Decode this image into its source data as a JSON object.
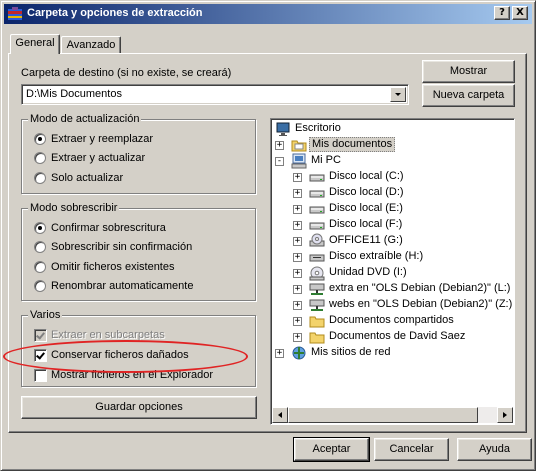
{
  "window": {
    "title": "Carpeta y opciones de extracción",
    "help_button": "?",
    "close_button": "X"
  },
  "tabs": [
    {
      "label": "General",
      "active": true
    },
    {
      "label": "Avanzado",
      "active": false
    }
  ],
  "destination": {
    "label": "Carpeta de destino (si no existe, se creará)",
    "value": "D:\\Mis Documentos",
    "show_button": "Mostrar",
    "new_folder_button": "Nueva carpeta"
  },
  "update_mode": {
    "legend": "Modo de actualización",
    "options": [
      {
        "label": "Extraer y reemplazar",
        "checked": true
      },
      {
        "label": "Extraer y actualizar",
        "checked": false
      },
      {
        "label": "Solo actualizar",
        "checked": false
      }
    ]
  },
  "overwrite_mode": {
    "legend": "Modo sobrescribir",
    "options": [
      {
        "label": "Confirmar sobrescritura",
        "checked": true
      },
      {
        "label": "Sobrescribir sin confirmación",
        "checked": false
      },
      {
        "label": "Omitir ficheros existentes",
        "checked": false
      },
      {
        "label": "Renombrar automaticamente",
        "checked": false
      }
    ]
  },
  "misc": {
    "legend": "Varios",
    "options": [
      {
        "label": "Extraer en subcarpetas",
        "checked": true,
        "disabled": true
      },
      {
        "label": "Conservar ficheros dañados",
        "checked": true,
        "disabled": false
      },
      {
        "label": "Mostrar ficheros en el Explorador",
        "checked": false,
        "disabled": false
      }
    ]
  },
  "save_options_button": "Guardar opciones",
  "tree": {
    "items": [
      {
        "label": "Escritorio",
        "icon": "desktop-icon",
        "level": 0,
        "expander": ""
      },
      {
        "label": "Mis documentos",
        "icon": "my-documents-folder-icon",
        "level": 1,
        "expander": "+",
        "selected": true
      },
      {
        "label": "Mi PC",
        "icon": "my-computer-icon",
        "level": 1,
        "expander": "-"
      },
      {
        "label": "Disco local (C:)",
        "icon": "hard-drive-icon",
        "level": 2,
        "expander": "+"
      },
      {
        "label": "Disco local (D:)",
        "icon": "hard-drive-icon",
        "level": 2,
        "expander": "+"
      },
      {
        "label": "Disco local (E:)",
        "icon": "hard-drive-icon",
        "level": 2,
        "expander": "+"
      },
      {
        "label": "Disco local (F:)",
        "icon": "hard-drive-icon",
        "level": 2,
        "expander": "+"
      },
      {
        "label": "OFFICE11 (G:)",
        "icon": "cd-drive-icon",
        "level": 2,
        "expander": "+"
      },
      {
        "label": "Disco extraíble (H:)",
        "icon": "removable-drive-icon",
        "level": 2,
        "expander": "+"
      },
      {
        "label": "Unidad DVD (I:)",
        "icon": "dvd-drive-icon",
        "level": 2,
        "expander": "+"
      },
      {
        "label": "extra en \"OLS Debian (Debian2)\" (L:)",
        "icon": "network-drive-icon",
        "level": 2,
        "expander": "+"
      },
      {
        "label": "webs en \"OLS Debian (Debian2)\" (Z:)",
        "icon": "network-drive-icon",
        "level": 2,
        "expander": "+"
      },
      {
        "label": "Documentos compartidos",
        "icon": "folder-icon",
        "level": 2,
        "expander": "+"
      },
      {
        "label": "Documentos de David Saez",
        "icon": "folder-icon",
        "level": 2,
        "expander": "+"
      },
      {
        "label": "Mis sitios de red",
        "icon": "network-places-icon",
        "level": 1,
        "expander": "+"
      }
    ]
  },
  "footer": {
    "accept": "Aceptar",
    "cancel": "Cancelar",
    "help": "Ayuda"
  },
  "colors": {
    "face": "#d4d0c8",
    "title_start": "#0a246a",
    "title_end": "#a6caf0",
    "annotation": "#e02424"
  }
}
